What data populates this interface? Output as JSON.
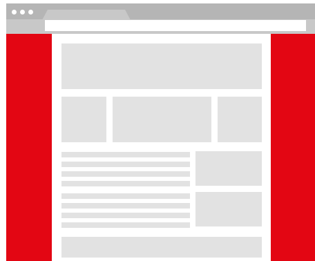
{
  "browser": {
    "title_bar_color": "#b5b5b5",
    "address_strip_color": "#c8c8c8",
    "address_bar_color": "#ffffff",
    "window_control_dot_color": "#ffffff",
    "window_controls": [
      "window-control-dot-1",
      "window-control-dot-2",
      "window-control-dot-3"
    ]
  },
  "theme": {
    "side_margin_color": "#e30613",
    "placeholder_color": "#e2e2e2",
    "page_background": "#ffffff"
  },
  "page": {
    "text_line_group_1": 4,
    "text_line_group_2": 4
  }
}
